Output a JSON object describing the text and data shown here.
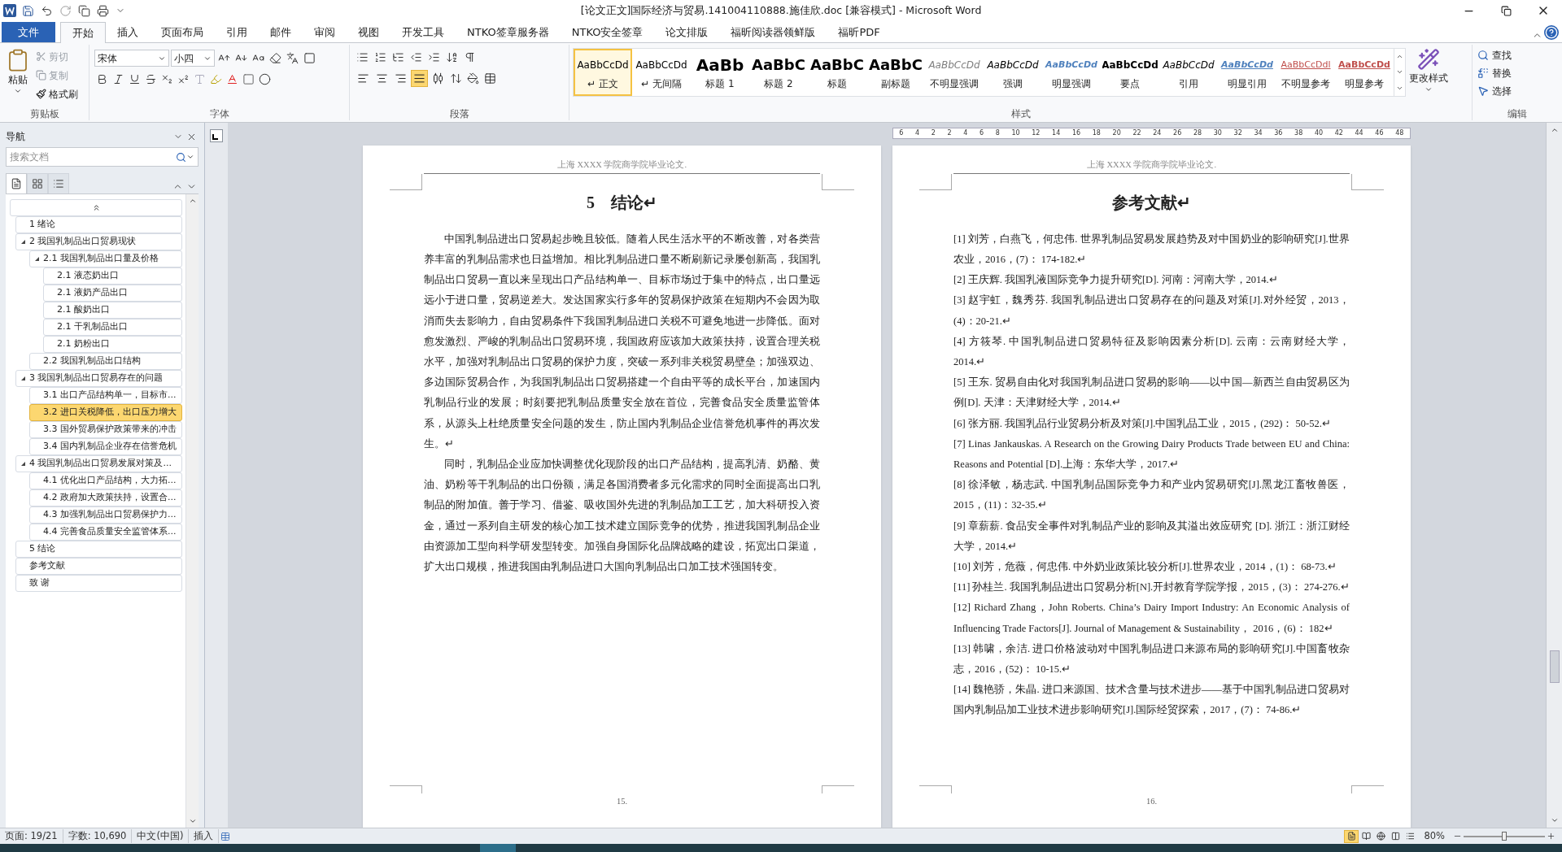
{
  "window": {
    "title": "[论文正文]国际经济与贸易.141004110888.施佳欣.doc [兼容模式] - Microsoft Word"
  },
  "ribbon_tabs": [
    {
      "label": "文件",
      "selected": false,
      "kind": "file"
    },
    {
      "label": "开始",
      "selected": true,
      "kind": "tab"
    },
    {
      "label": "插入",
      "selected": false,
      "kind": "tab"
    },
    {
      "label": "页面布局",
      "selected": false,
      "kind": "tab"
    },
    {
      "label": "引用",
      "selected": false,
      "kind": "tab"
    },
    {
      "label": "邮件",
      "selected": false,
      "kind": "tab"
    },
    {
      "label": "审阅",
      "selected": false,
      "kind": "tab"
    },
    {
      "label": "视图",
      "selected": false,
      "kind": "tab"
    },
    {
      "label": "开发工具",
      "selected": false,
      "kind": "tab"
    },
    {
      "label": "NTKO签章服务器",
      "selected": false,
      "kind": "tab"
    },
    {
      "label": "NTKO安全签章",
      "selected": false,
      "kind": "tab"
    },
    {
      "label": "论文排版",
      "selected": false,
      "kind": "tab"
    },
    {
      "label": "福昕阅读器领鲜版",
      "selected": false,
      "kind": "tab"
    },
    {
      "label": "福昕PDF",
      "selected": false,
      "kind": "tab"
    }
  ],
  "clipboard": {
    "paste": "粘贴",
    "group_label": "剪贴板",
    "tools": [
      {
        "label": "剪切",
        "disabled": true
      },
      {
        "label": "复制",
        "disabled": true
      },
      {
        "label": "格式刷",
        "disabled": false
      }
    ]
  },
  "font": {
    "name": "宋体",
    "size": "小四",
    "group_label": "字体"
  },
  "paragraph": {
    "group_label": "段落",
    "alignment": [
      {
        "selected": false
      },
      {
        "selected": false
      },
      {
        "selected": false
      },
      {
        "selected": true
      },
      {
        "selected": false
      }
    ]
  },
  "styles": {
    "group_label": "样式",
    "change_styles": "更改样式",
    "items": [
      {
        "sample": "AaBbCcDd",
        "label": "↵ 正文",
        "selected": true,
        "kind": "normal"
      },
      {
        "sample": "AaBbCcDd",
        "label": "↵ 无间隔",
        "selected": false,
        "kind": "normal"
      },
      {
        "sample": "AaBb",
        "label": "标题 1",
        "selected": false,
        "kind": "heading1"
      },
      {
        "sample": "AaBbC",
        "label": "标题 2",
        "selected": false,
        "kind": "heading"
      },
      {
        "sample": "AaBbC",
        "label": "标题",
        "selected": false,
        "kind": "heading"
      },
      {
        "sample": "AaBbC",
        "label": "副标题",
        "selected": false,
        "kind": "heading"
      },
      {
        "sample": "AaBbCcDd",
        "label": "不明显强调",
        "selected": false,
        "kind": "subtle"
      },
      {
        "sample": "AaBbCcDd",
        "label": "强调",
        "selected": false,
        "kind": "emphasis"
      },
      {
        "sample": "AaBbCcDd",
        "label": "明显强调",
        "selected": false,
        "kind": "intense"
      },
      {
        "sample": "AaBbCcDd",
        "label": "要点",
        "selected": false,
        "kind": "strong"
      },
      {
        "sample": "AaBbCcDd",
        "label": "引用",
        "selected": false,
        "kind": "emphasis"
      },
      {
        "sample": "AaBbCcDd",
        "label": "明显引用",
        "selected": false,
        "kind": "intense_quote"
      },
      {
        "sample": "AaBbCcDdl",
        "label": "不明显参考",
        "selected": false,
        "kind": "subtle_ref"
      },
      {
        "sample": "AaBbCcDd",
        "label": "明显参考",
        "selected": false,
        "kind": "intense_ref"
      }
    ]
  },
  "editing": {
    "group_label": "编辑",
    "items": [
      "查找",
      "替换",
      "选择"
    ]
  },
  "navigation": {
    "title": "导航",
    "search_placeholder": "搜索文档",
    "views": [
      {
        "selected": true
      },
      {
        "selected": false
      },
      {
        "selected": false
      }
    ],
    "tree": [
      {
        "label": "1 绪论",
        "expanded": false,
        "selected": false
      },
      {
        "label": "2 我国乳制品出口贸易现状",
        "expanded": true,
        "selected": false,
        "children": [
          {
            "label": "2.1 我国乳制品出口量及价格",
            "expanded": true,
            "selected": false,
            "children": [
              {
                "label": "2.1 液态奶出口",
                "expanded": false,
                "selected": false
              },
              {
                "label": "2.1 液奶产品出口",
                "expanded": false,
                "selected": false
              },
              {
                "label": "2.1 酸奶出口",
                "expanded": false,
                "selected": false
              },
              {
                "label": "2.1 干乳制品出口",
                "expanded": false,
                "selected": false
              },
              {
                "label": "2.1 奶粉出口",
                "expanded": false,
                "selected": false
              }
            ]
          },
          {
            "label": "2.2 我国乳制品出口结构",
            "expanded": false,
            "selected": false
          }
        ]
      },
      {
        "label": "3 我国乳制品出口贸易存在的问题",
        "expanded": true,
        "selected": false,
        "children": [
          {
            "label": "3.1 出口产品结构单一，目标市...",
            "expanded": false,
            "selected": false
          },
          {
            "label": "3.2 进口关税降低，出口压力增大",
            "expanded": false,
            "selected": true
          },
          {
            "label": "3.3 国外贸易保护政策带来的冲击",
            "expanded": false,
            "selected": false
          },
          {
            "label": "3.4 国内乳制品企业存在信誉危机",
            "expanded": false,
            "selected": false
          }
        ]
      },
      {
        "label": "4 我国乳制品出口贸易发展对策及...",
        "expanded": true,
        "selected": false,
        "children": [
          {
            "label": "4.1 优化出口产品结构，大力拓...",
            "expanded": false,
            "selected": false
          },
          {
            "label": "4.2 政府加大政策扶持，设置合...",
            "expanded": false,
            "selected": false
          },
          {
            "label": "4.3 加强乳制品出口贸易保护力...",
            "expanded": false,
            "selected": false
          },
          {
            "label": "4.4 完善食品质量安全监管体系...",
            "expanded": false,
            "selected": false
          }
        ]
      },
      {
        "label": "5 结论",
        "expanded": false,
        "selected": false
      },
      {
        "label": "参考文献",
        "expanded": false,
        "selected": false
      },
      {
        "label": "致  谢",
        "expanded": false,
        "selected": false
      }
    ]
  },
  "ruler": {
    "ticks": [
      "6",
      "4",
      "2",
      "2",
      "4",
      "6",
      "8",
      "10",
      "12",
      "14",
      "16",
      "18",
      "20",
      "22",
      "24",
      "26",
      "28",
      "30",
      "32",
      "34",
      "36",
      "38",
      "40",
      "42",
      "44",
      "46",
      "48"
    ]
  },
  "pages": [
    {
      "kind": "body",
      "header": "上海 XXXX 学院商学院毕业论文.",
      "heading": "5　结论↵",
      "page_number": "15.",
      "paragraphs": [
        "中国乳制品进出口贸易起步晚且较低。随着人民生活水平的不断改善，对各类营养丰富的乳制品需求也日益增加。相比乳制品进口量不断刷新记录屡创新高，我国乳制品出口贸易一直以来呈现出口产品结构单一、目标市场过于集中的特点，出口量远远小于进口量，贸易逆差大。发达国家实行多年的贸易保护政策在短期内不会因为取消而失去影响力，自由贸易条件下我国乳制品进口关税不可避免地进一步降低。面对愈发激烈、严峻的乳制品出口贸易环境，我国政府应该加大政策扶持，设置合理关税水平，加强对乳制品出口贸易的保护力度，突破一系列非关税贸易壁垒；加强双边、多边国际贸易合作，为我国乳制品出口贸易搭建一个自由平等的成长平台，加速国内乳制品行业的发展；时刻要把乳制品质量安全放在首位，完善食品安全质量监管体系，从源头上杜绝质量安全问题的发生，防止国内乳制品企业信誉危机事件的再次发生。↵",
        "同时，乳制品企业应加快调整优化现阶段的出口产品结构，提高乳清、奶酪、黄油、奶粉等干乳制品的出口份额，满足各国消费者多元化需求的同时全面提高出口乳制品的附加值。善于学习、借鉴、吸收国外先进的乳制品加工工艺，加大科研投入资金，通过一系列自主研发的核心加工技术建立国际竞争的优势，推进我国乳制品企业由资源加工型向科学研发型转变。加强自身国际化品牌战略的建设，拓宽出口渠道，扩大出口规模，推进我国由乳制品进口大国向乳制品出口加工技术强国转变。"
      ]
    },
    {
      "kind": "references",
      "header": "上海 XXXX 学院商学院毕业论文.",
      "heading": "参考文献↵",
      "page_number": "16.",
      "paragraphs": [
        "[1] 刘芳，白燕飞，何忠伟. 世界乳制品贸易发展趋势及对中国奶业的影响研究[J].世界农业，2016，(7)： 174-182.↵",
        "[2] 王庆辉. 我国乳液国际竞争力提升研究[D]. 河南：河南大学，2014.↵",
        "[3] 赵宇虹，魏秀芬. 我国乳制品进出口贸易存在的问题及对策[J].对外经贸，2013，(4)：20-21.↵",
        "[4] 方筱琴. 中国乳制品进口贸易特征及影响因素分析[D]. 云南：云南财经大学，2014.↵",
        "[5] 王东. 贸易自由化对我国乳制品进口贸易的影响——以中国—新西兰自由贸易区为例[D]. 天津：天津财经大学，2014.↵",
        "[6] 张方丽. 我国乳品行业贸易分析及对策[J].中国乳品工业，2015，(292)： 50-52.↵",
        "[7] Linas Jankauskas. A Research on the Growing Dairy Products Trade between EU and China: Reasons and Potential [D].上海：东华大学，2017.↵",
        "[8] 徐泽敏，杨志武. 中国乳制品国际竞争力和产业内贸易研究[J].黑龙江畜牧兽医，2015，(11)：32-35.↵",
        "[9] 章薪薪. 食品安全事件对乳制品产业的影响及其溢出效应研究 [D]. 浙江：浙江财经大学，2014.↵",
        "[10] 刘芳，危薇，何忠伟. 中外奶业政策比较分析[J].世界农业，2014，(1)： 68-73.↵",
        "[11] 孙桂兰. 我国乳制品进出口贸易分析[N].开封教育学院学报，2015，(3)： 274-276.↵",
        "[12] Richard Zhang，John Roberts. China’s Dairy Import Industry: An Economic Analysis of Influencing Trade Factors[J]. Journal of Management & Sustainability， 2016，(6)： 182↵",
        "[13] 韩啸，余洁. 进口价格波动对中国乳制品进口来源布局的影响研究[J].中国畜牧杂志，2016，(52)： 10-15.↵",
        "[14] 魏艳骄，朱晶. 进口来源国、技术含量与技术进步——基于中国乳制品进口贸易对国内乳制品加工业技术进步影响研究[J].国际经贸探索，2017，(7)： 74-86.↵"
      ]
    }
  ],
  "status_bar": {
    "page": "页面: 19/21",
    "words": "字数: 10,690",
    "language": "中文(中国)",
    "mode": "插入",
    "zoom": "80%",
    "zoom_slider": {
      "level": 0.5
    },
    "views": [
      {
        "selected": true
      },
      {
        "selected": false
      },
      {
        "selected": false
      },
      {
        "selected": false
      },
      {
        "selected": false
      }
    ]
  }
}
